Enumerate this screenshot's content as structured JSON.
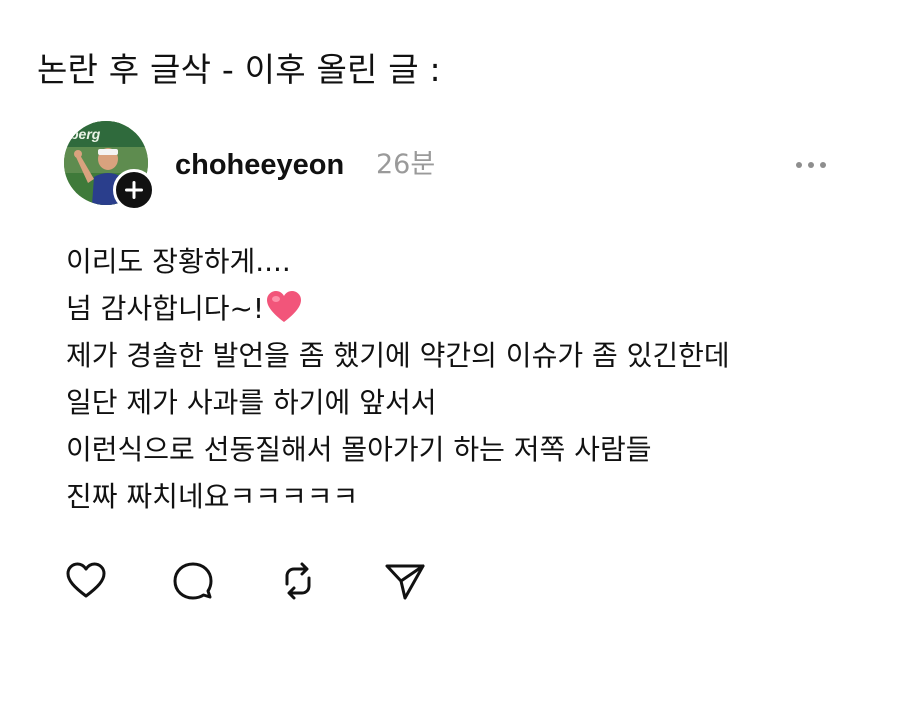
{
  "caption": "논란 후 글삭 - 이후 올린 글 :",
  "post": {
    "username": "choheeyeon",
    "time": "26분",
    "lines": [
      "이리도 장황하게....",
      "넘 감사합니다~!",
      "제가 경솔한 발언을 좀 했기에 약간의 이슈가 좀 있긴한데",
      "일단 제가 사과를 하기에 앞서서",
      "이런식으로 선동질해서 몰아가기 하는 저쪽 사람들",
      "진짜 짜치네요ㅋㅋㅋㅋㅋ"
    ],
    "line2_emoji": "pink-heart-emoji"
  },
  "icons": {
    "follow": "plus-icon",
    "more": "more-dots-icon",
    "like": "heart-outline-icon",
    "comment": "comment-bubble-icon",
    "repost": "repost-icon",
    "share": "send-icon"
  },
  "colors": {
    "text": "#111111",
    "muted": "#9a9a9a",
    "heart": "#f2557a",
    "background": "#ffffff"
  }
}
